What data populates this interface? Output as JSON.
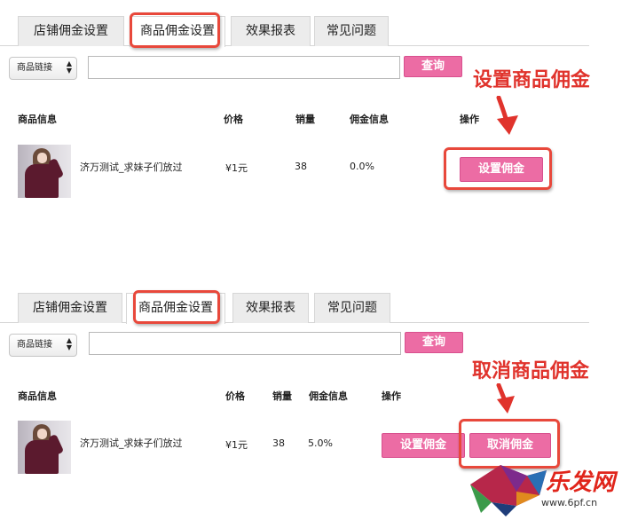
{
  "tabs": [
    "店铺佣金设置",
    "商品佣金设置",
    "效果报表",
    "常见问题"
  ],
  "search": {
    "select_label": "商品链接",
    "input_value": "",
    "button_label": "查询"
  },
  "table": {
    "headers": [
      "商品信息",
      "价格",
      "销量",
      "佣金信息",
      "操作"
    ]
  },
  "panel_1": {
    "annotation": "设置商品佣金",
    "row": {
      "product_name": "济万测试_求妹子们放过",
      "price": "¥1元",
      "sales": "38",
      "commission": "0.0%",
      "set_button": "设置佣金"
    }
  },
  "panel_2": {
    "annotation": "取消商品佣金",
    "row": {
      "product_name": "济万测试_求妹子们放过",
      "price": "¥1元",
      "sales": "38",
      "commission": "5.0%",
      "set_button": "设置佣金",
      "cancel_button": "取消佣金"
    }
  },
  "watermark": {
    "brand": "乐发网",
    "url": "www.6pf.cn"
  },
  "colors": {
    "accent_pink": "#ec6ca4",
    "highlight_red": "#e8483b",
    "annotation_red": "#e0332c"
  }
}
